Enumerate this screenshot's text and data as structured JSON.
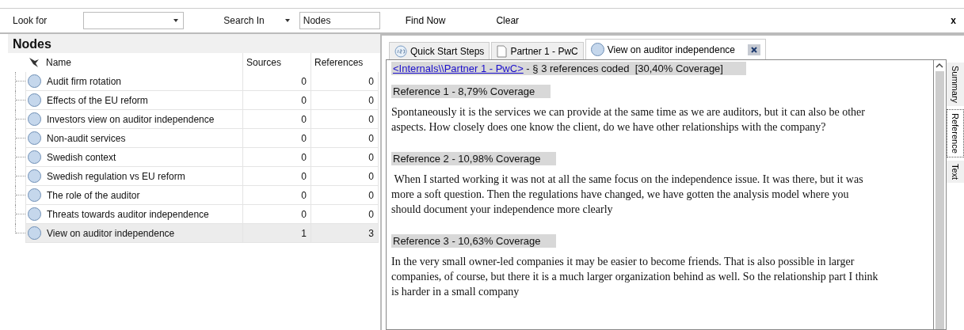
{
  "toolbar": {
    "look_for_label": "Look for",
    "search_in_label": "Search In",
    "search_in_value": "Nodes",
    "find_now": "Find Now",
    "clear": "Clear",
    "close": "x"
  },
  "nodes_panel": {
    "title": "Nodes",
    "columns": [
      "Name",
      "Sources",
      "References"
    ],
    "rows": [
      {
        "name": "Audit firm rotation",
        "sources": "0",
        "references": "0",
        "selected": false
      },
      {
        "name": "Effects of the EU reform",
        "sources": "0",
        "references": "0",
        "selected": false
      },
      {
        "name": "Investors view on auditor independence",
        "sources": "0",
        "references": "0",
        "selected": false
      },
      {
        "name": "Non-audit services",
        "sources": "0",
        "references": "0",
        "selected": false
      },
      {
        "name": "Swedish context",
        "sources": "0",
        "references": "0",
        "selected": false
      },
      {
        "name": "Swedish regulation vs EU reform",
        "sources": "0",
        "references": "0",
        "selected": false
      },
      {
        "name": "The role of the auditor",
        "sources": "0",
        "references": "0",
        "selected": false
      },
      {
        "name": "Threats towards auditor independence",
        "sources": "0",
        "references": "0",
        "selected": false
      },
      {
        "name": "View on auditor independence",
        "sources": "1",
        "references": "3",
        "selected": true
      }
    ]
  },
  "tabs": [
    {
      "label": "Quick Start Steps",
      "kind": "steps",
      "selected": false
    },
    {
      "label": "Partner 1 - PwC",
      "kind": "document",
      "selected": false
    },
    {
      "label": "View on auditor independence",
      "kind": "node",
      "selected": true
    }
  ],
  "content": {
    "source_link": "<Internals\\\\Partner 1 - PwC>",
    "source_summary": " - § 3 references coded  [30,40% Coverage]",
    "references": [
      {
        "heading": "Reference 1 - 8,79% Coverage",
        "text": "Spontaneously it is the services we can provide at the same time as we are auditors, but it can also be other aspects. How closely does one know the client, do we have other relationships with the company?"
      },
      {
        "heading": "Reference 2 - 10,98% Coverage",
        "text": " When I started working it was not at all the same focus on the independence issue. It was there, but it was more a soft question. Then the regulations have changed, we have gotten the analysis model where you should document your independence more clearly"
      },
      {
        "heading": "Reference 3 - 10,63% Coverage",
        "text": "In the very small owner-led companies it may be easier to become friends. That is also possible in larger companies, of course, but there it is a much larger organization behind as well. So the relationship part I think is harder in a small company"
      }
    ]
  },
  "side_tabs": [
    {
      "label": "Summary",
      "selected": false
    },
    {
      "label": "Reference",
      "selected": true
    },
    {
      "label": "Text",
      "selected": false
    }
  ]
}
